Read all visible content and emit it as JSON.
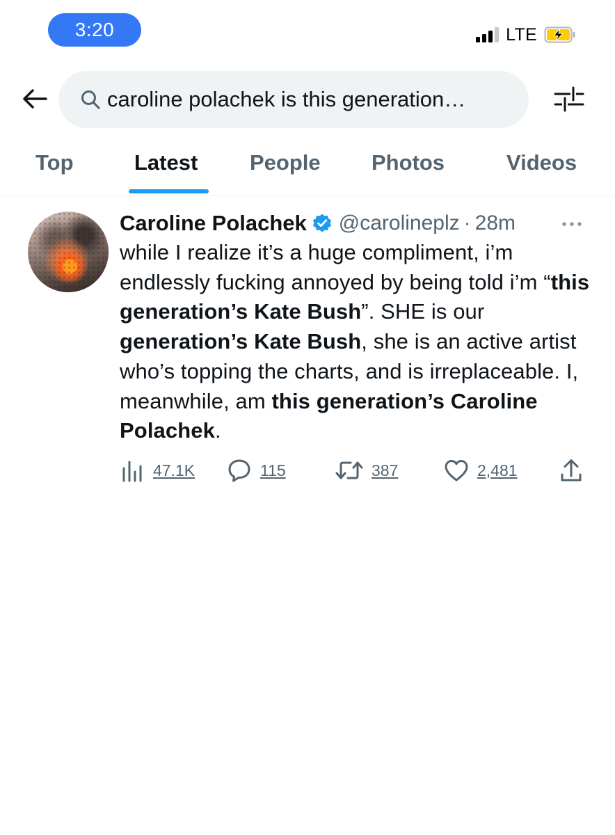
{
  "status_bar": {
    "time": "3:20",
    "network": "LTE",
    "colors": {
      "time_pill": "#3478f6",
      "battery_fill": "#ffcc00"
    }
  },
  "search": {
    "query": "caroline polachek is this generation…"
  },
  "tabs": [
    {
      "label": "Top",
      "active": false
    },
    {
      "label": "Latest",
      "active": true
    },
    {
      "label": "People",
      "active": false
    },
    {
      "label": "Photos",
      "active": false
    },
    {
      "label": "Videos",
      "active": false
    }
  ],
  "tweet": {
    "display_name": "Caroline Polachek",
    "handle": "@carolineplz",
    "separator": "·",
    "time": "28m",
    "verified": true,
    "body_segments": [
      {
        "text": "while I realize it’s a huge compliment, i’m endlessly fucking annoyed by being told i’m “",
        "bold": false
      },
      {
        "text": "this generation’s Kate Bush",
        "bold": true
      },
      {
        "text": "”. SHE is our ",
        "bold": false
      },
      {
        "text": "generation’s Kate Bush",
        "bold": true
      },
      {
        "text": ", she is an active artist who’s topping the charts, and is irreplaceable. I, meanwhile, am ",
        "bold": false
      },
      {
        "text": "this generation’s Caroline Polachek",
        "bold": true
      },
      {
        "text": ".",
        "bold": false
      }
    ],
    "metrics": {
      "views": "47.1K",
      "replies": "115",
      "retweets": "387",
      "likes": "2,481"
    }
  },
  "colors": {
    "accent": "#1d9bf0",
    "text_primary": "#0f1419",
    "text_secondary": "#536471",
    "search_bg": "#eff3f4"
  }
}
